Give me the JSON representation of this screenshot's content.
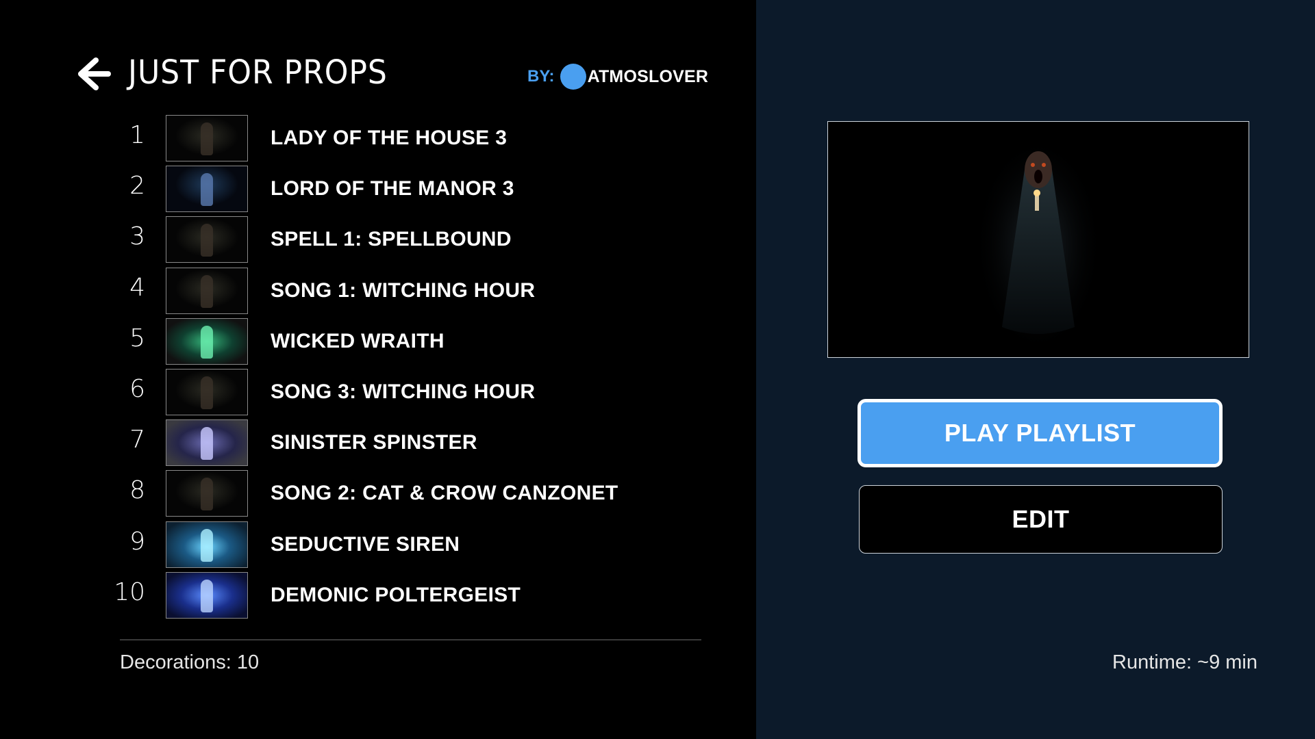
{
  "header": {
    "title": "JUST FOR PROPS",
    "by_label": "BY:",
    "author": "ATMOSLOVER",
    "back_icon": "arrow-left-icon"
  },
  "tracks": [
    {
      "number": "1",
      "title": "LADY OF THE HOUSE 3",
      "thumb": "dark"
    },
    {
      "number": "2",
      "title": "LORD OF THE MANOR 3",
      "thumb": "blue"
    },
    {
      "number": "3",
      "title": "SPELL 1: SPELLBOUND",
      "thumb": "dark"
    },
    {
      "number": "4",
      "title": "SONG 1: WITCHING HOUR",
      "thumb": "dark"
    },
    {
      "number": "5",
      "title": "WICKED WRAITH",
      "thumb": "green"
    },
    {
      "number": "6",
      "title": "SONG 3: WITCHING HOUR",
      "thumb": "dark"
    },
    {
      "number": "7",
      "title": "SINISTER SPINSTER",
      "thumb": "violet"
    },
    {
      "number": "8",
      "title": "SONG 2: CAT & CROW CANZONET",
      "thumb": "dark"
    },
    {
      "number": "9",
      "title": "SEDUCTIVE SIREN",
      "thumb": "cyan"
    },
    {
      "number": "10",
      "title": "DEMONIC POLTERGEIST",
      "thumb": "electric"
    }
  ],
  "footer": {
    "decorations": "Decorations: 10",
    "runtime": "Runtime: ~9 min"
  },
  "actions": {
    "play_label": "PLAY PLAYLIST",
    "edit_label": "EDIT"
  },
  "colors": {
    "accent": "#4a9ff0",
    "left_bg": "#000000",
    "right_bg": "#0c1a2a"
  }
}
